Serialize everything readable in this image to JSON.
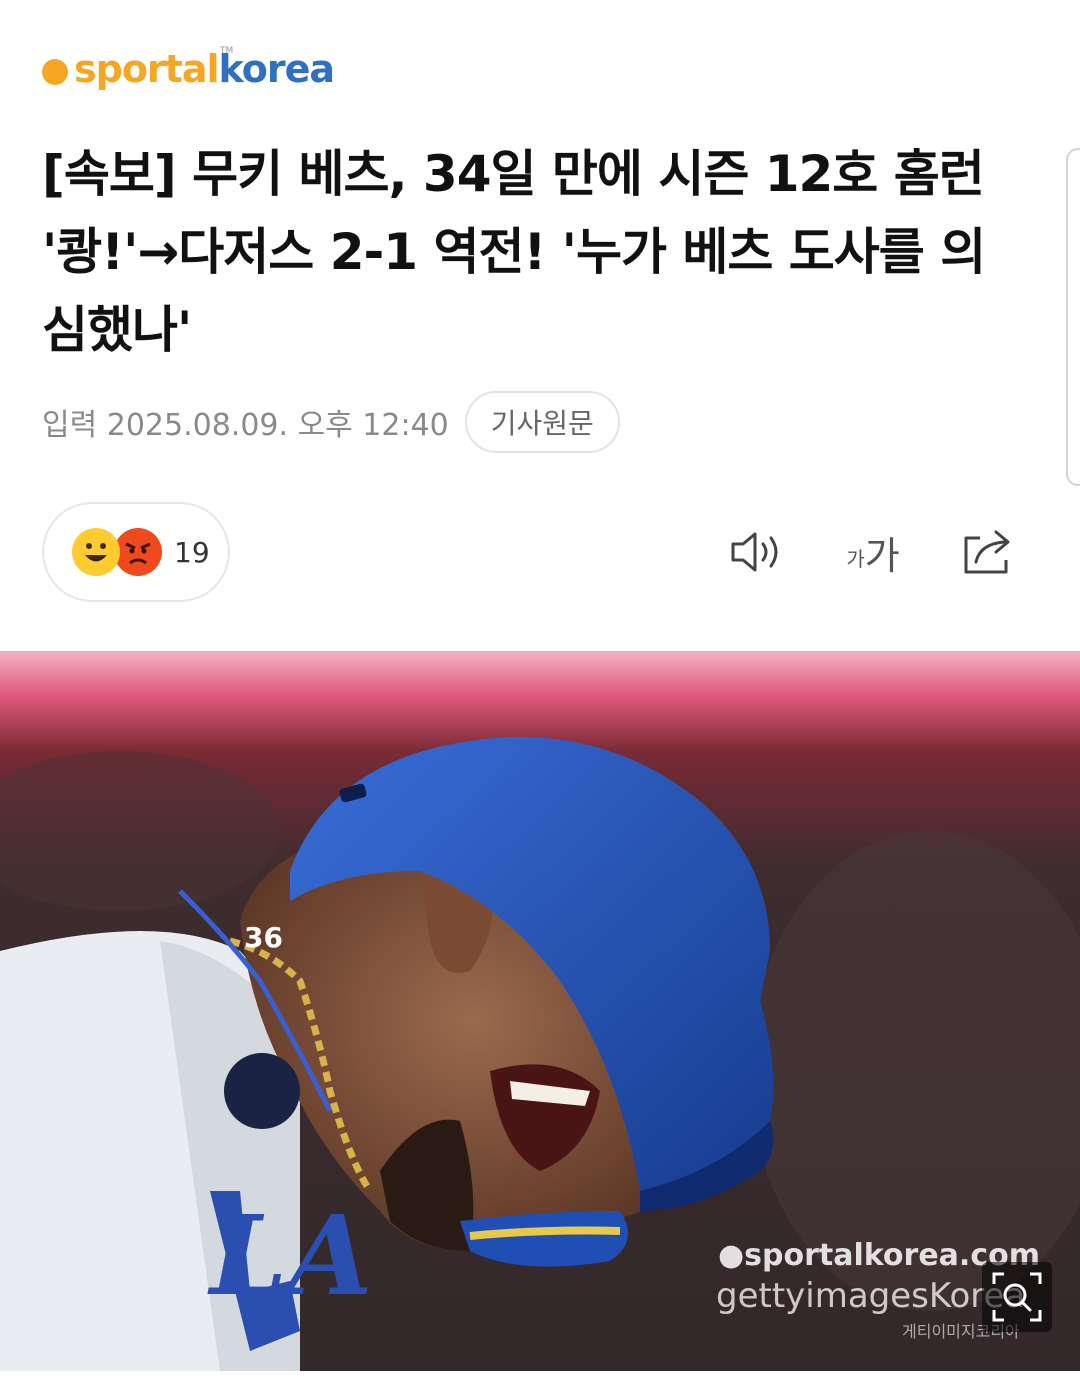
{
  "logo": {
    "part1": "sportal",
    "part2": "korea",
    "tm": "TM"
  },
  "article": {
    "title": "[속보] 무키 베츠, 34일 만에 시즌 12호 홈런 '쾅!'→다저스 2-1 역전! '누가 베츠 도사를 의심했나'",
    "published": "입력 2025.08.09. 오후 12:40",
    "origin_button": "기사원문"
  },
  "reactions": {
    "count": "19",
    "icons": [
      "smile-emoji",
      "angry-emoji"
    ]
  },
  "toolbar": {
    "font_small": "가",
    "font_big": "가",
    "icons": [
      "speaker-icon",
      "font-size-icon",
      "share-icon"
    ]
  },
  "photo": {
    "watermark_line1": "●sportalkorea.com",
    "watermark_line2": "gettyimagesKorea",
    "watermark_line3": "게티이미지코리아",
    "badge_number": "36",
    "jersey_text": "LA"
  },
  "colors": {
    "brand_orange": "#f5a623",
    "brand_blue": "#2f6fc4",
    "helmet_blue": "#1f4fb5"
  }
}
